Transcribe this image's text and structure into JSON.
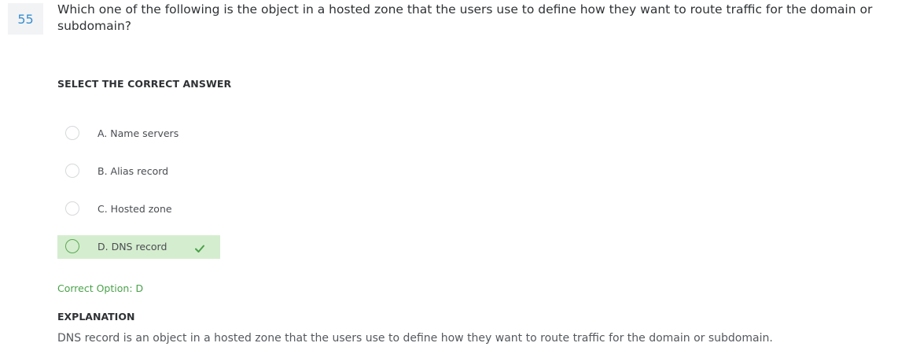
{
  "question": {
    "number": "55",
    "text": "Which one of the following is the object in a hosted zone that the users use to define how they want to route traffic for the domain or subdomain?"
  },
  "select_label": "SELECT THE CORRECT ANSWER",
  "options": [
    {
      "label": "A. Name servers",
      "correct": false
    },
    {
      "label": "B. Alias record",
      "correct": false
    },
    {
      "label": "C. Hosted zone",
      "correct": false
    },
    {
      "label": "D. DNS record",
      "correct": true
    }
  ],
  "correct_option": "Correct Option: D",
  "explanation": {
    "title": "EXPLANATION",
    "text": "DNS record is an object in a hosted zone that the users use to define how they want to route traffic for the domain or subdomain."
  },
  "colors": {
    "accent_number": "#3a8fd0",
    "correct_bg": "#d5edcf",
    "correct_green": "#4aa14a"
  },
  "icons": {
    "correct_mark": "checkmark-icon",
    "option_marker": "radio-icon"
  }
}
